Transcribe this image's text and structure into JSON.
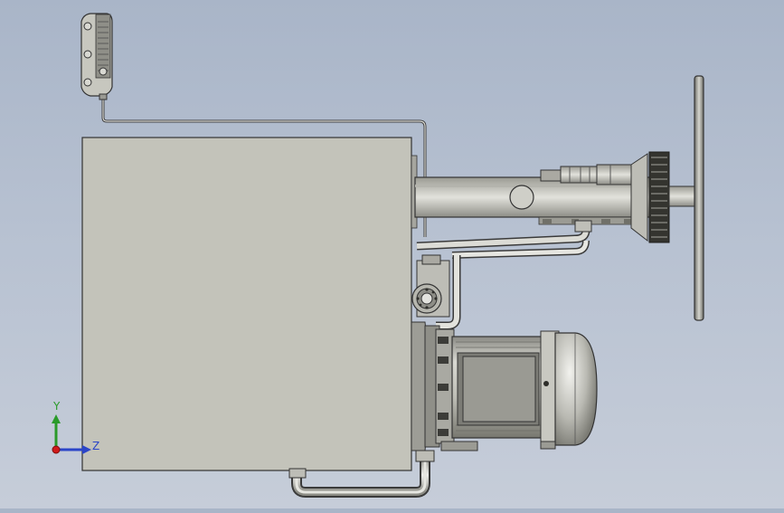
{
  "view": {
    "background_top": "#a9b5c8",
    "background_bottom": "#c6cdd9",
    "model_color": "#c3c3ba",
    "edge_color": "#3a3a3a"
  },
  "triad": {
    "y_label": "Y",
    "z_label": "Z",
    "y_color": "#2a9a2a",
    "z_color": "#2b45c8",
    "x_color": "#d01a1a"
  }
}
